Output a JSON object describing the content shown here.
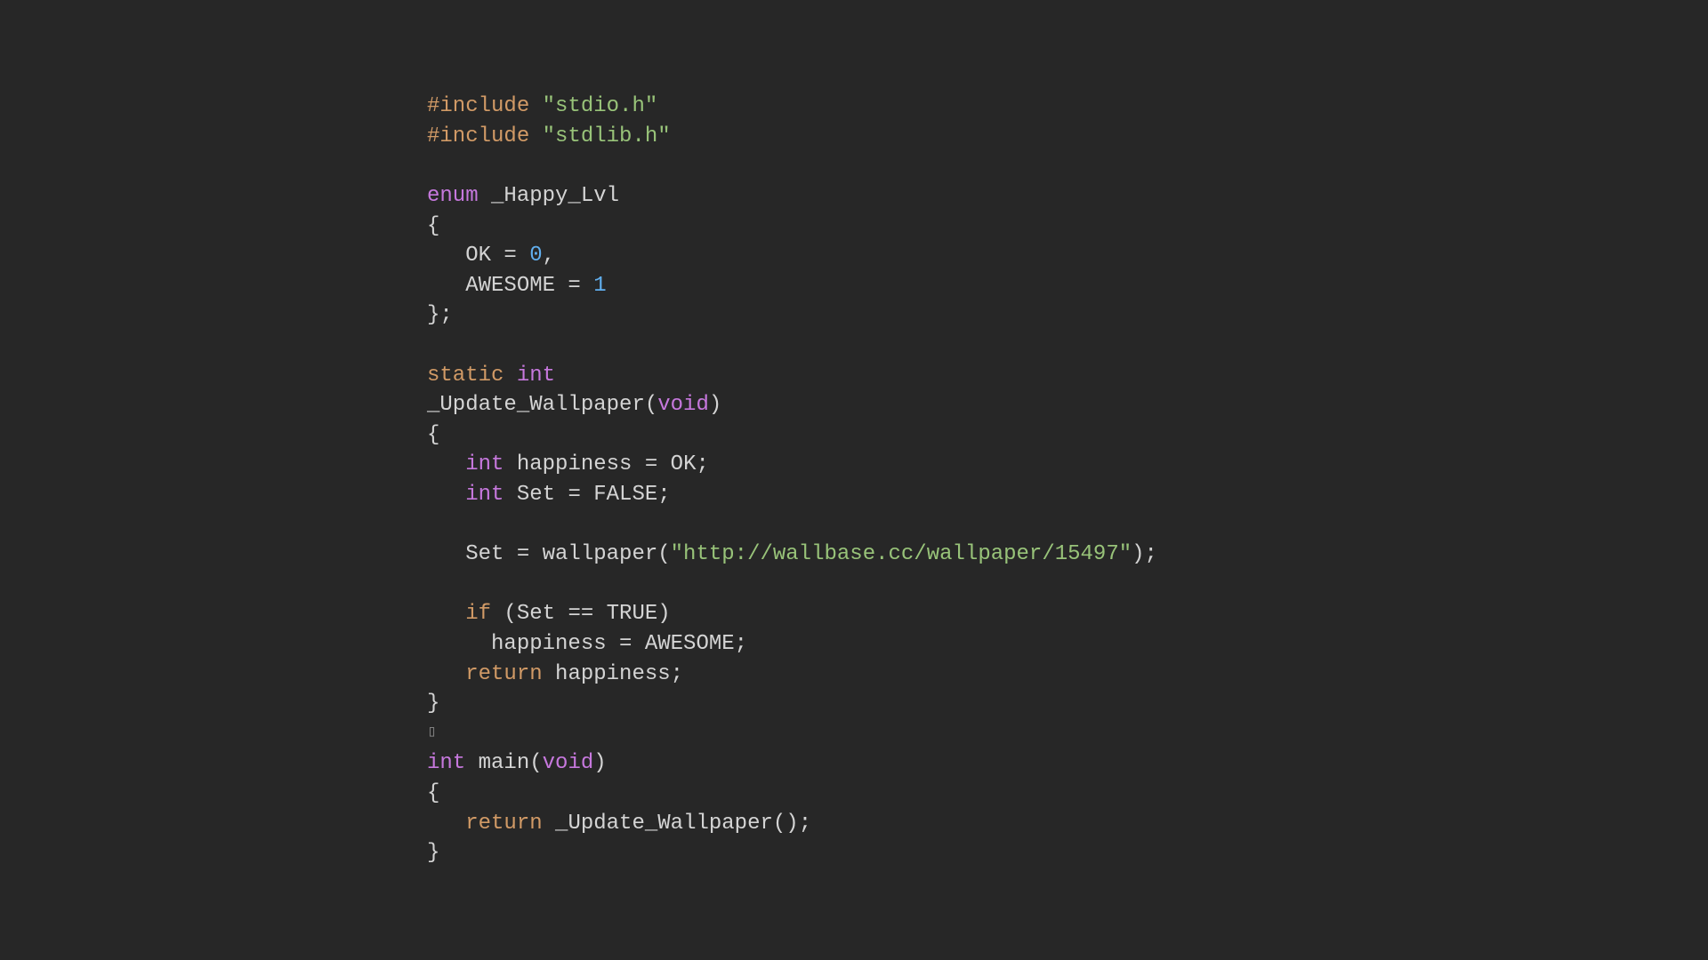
{
  "code": {
    "line1_include": "#include",
    "line1_string": " \"stdio.h\"",
    "line2_include": "#include",
    "line2_string": " \"stdlib.h\"",
    "line4_enum": "enum",
    "line4_name": " _Happy_Lvl",
    "line5": "{",
    "line6_indent": "   OK = ",
    "line6_num": "0",
    "line6_end": ",",
    "line7_indent": "   AWESOME = ",
    "line7_num": "1",
    "line8": "};",
    "line10_static": "static",
    "line10_int": " int",
    "line11_name": "_Update_Wallpaper(",
    "line11_void": "void",
    "line11_end": ")",
    "line12": "{",
    "line13_indent": "   ",
    "line13_int": "int",
    "line13_rest": " happiness = OK;",
    "line14_indent": "   ",
    "line14_int": "int",
    "line14_rest": " Set = FALSE;",
    "line16_indent": "   Set = wallpaper(",
    "line16_string": "\"http://wallbase.cc/wallpaper/15497\"",
    "line16_end": ");",
    "line18_indent": "   ",
    "line18_if": "if",
    "line18_rest": " (Set == TRUE)",
    "line19": "     happiness = AWESOME;",
    "line20_indent": "   ",
    "line20_return": "return",
    "line20_rest": " happiness;",
    "line21": "}",
    "line22_box": "▯",
    "line23_int": "int",
    "line23_main": " main(",
    "line23_void": "void",
    "line23_end": ")",
    "line24": "{",
    "line25_indent": "   ",
    "line25_return": "return",
    "line25_rest": " _Update_Wallpaper();",
    "line26": "}"
  },
  "colors": {
    "background": "#272727",
    "default": "#d4d4d4",
    "preprocessor": "#d19a66",
    "string": "#98c379",
    "keyword": "#c678dd",
    "number": "#61afef"
  }
}
